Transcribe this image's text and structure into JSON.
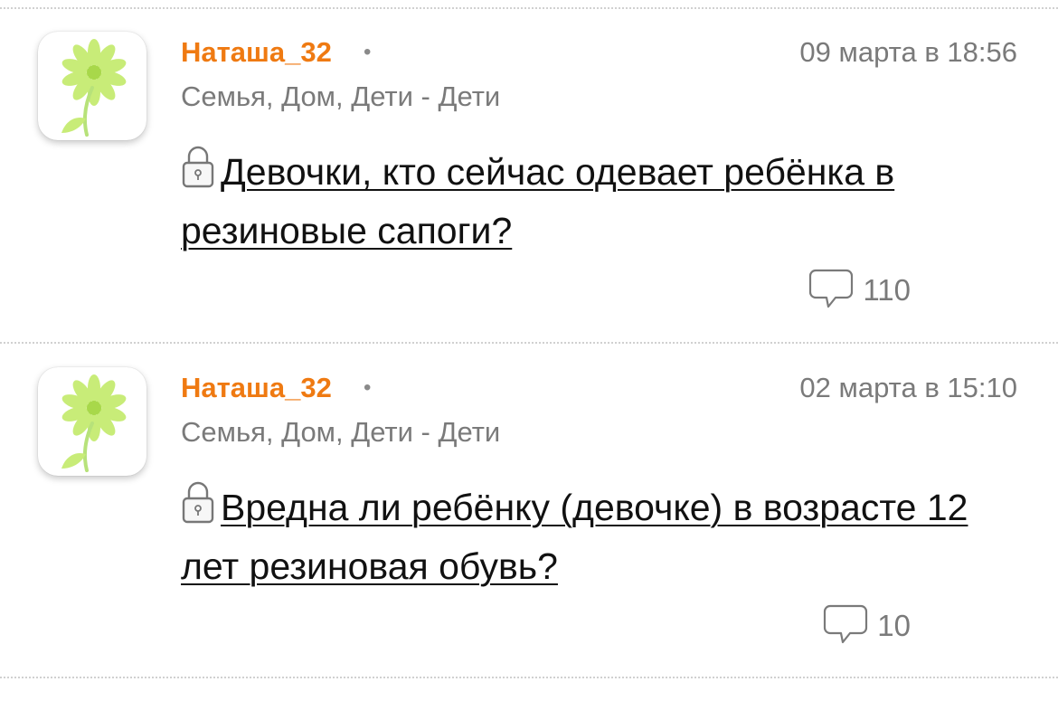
{
  "posts": [
    {
      "author": "Наташа_32",
      "separator": "•",
      "date": "09 марта в 18:56",
      "category": "Семья, Дом, Дети - Дети",
      "title": "Девочки, кто сейчас одевает ребёнка в резиновые сапоги?",
      "comments": "110",
      "avatar_icon": "flower-icon",
      "lock_icon": "lock-icon",
      "comment_icon": "speech-bubble-icon"
    },
    {
      "author": "Наташа_32",
      "separator": "•",
      "date": "02 марта в 15:10",
      "category": "Семья, Дом, Дети - Дети",
      "title": "Вредна ли ребёнку (девочке) в возрасте 12 лет резиновая обувь?",
      "comments": "10",
      "avatar_icon": "flower-icon",
      "lock_icon": "lock-icon",
      "comment_icon": "speech-bubble-icon"
    }
  ],
  "colors": {
    "author": "#ef7a12",
    "meta": "#7a7a7a",
    "flower_petal": "#c8ec78",
    "flower_center": "#a8d84a",
    "stem": "#b7e27a"
  }
}
